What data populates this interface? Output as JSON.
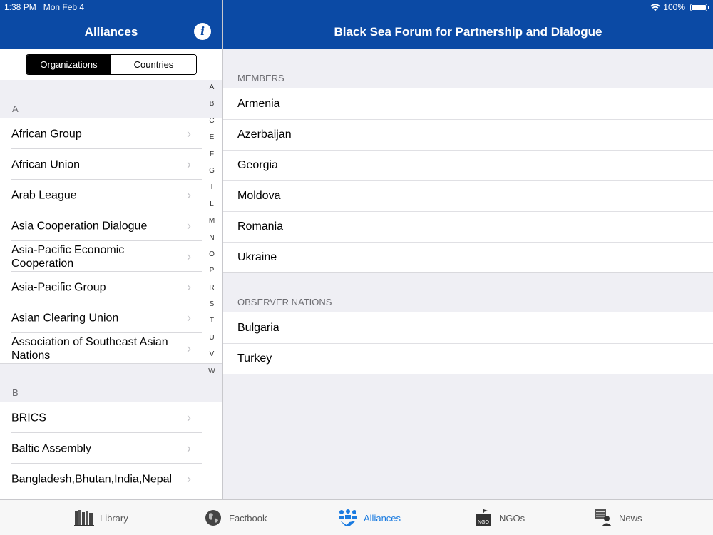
{
  "status": {
    "time": "1:38 PM",
    "date": "Mon Feb 4",
    "battery": "100%"
  },
  "left_nav": {
    "title": "Alliances"
  },
  "right_nav": {
    "title": "Black Sea Forum for Partnership and Dialogue"
  },
  "segment": {
    "organizations": "Organizations",
    "countries": "Countries",
    "selected": "Organizations"
  },
  "sections": [
    {
      "header": "A",
      "items": [
        "African Group",
        "African Union",
        "Arab League",
        "Asia Cooperation Dialogue",
        "Asia-Pacific Economic Cooperation",
        "Asia-Pacific Group",
        "Asian Clearing Union",
        "Association of Southeast Asian Nations"
      ]
    },
    {
      "header": "B",
      "items": [
        "BRICS",
        "Baltic Assembly",
        "Bangladesh,Bhutan,India,Nepal"
      ]
    }
  ],
  "index_letters": [
    "A",
    "B",
    "C",
    "E",
    "F",
    "G",
    "I",
    "L",
    "M",
    "N",
    "O",
    "P",
    "R",
    "S",
    "T",
    "U",
    "V",
    "W"
  ],
  "detail": {
    "members_header": "MEMBERS",
    "members": [
      "Armenia",
      "Azerbaijan",
      "Georgia",
      "Moldova",
      "Romania",
      "Ukraine"
    ],
    "observers_header": "OBSERVER NATIONS",
    "observers": [
      "Bulgaria",
      "Turkey"
    ]
  },
  "tabs": {
    "library": "Library",
    "factbook": "Factbook",
    "alliances": "Alliances",
    "ngos": "NGOs",
    "news": "News",
    "active": "Alliances"
  },
  "colors": {
    "nav_bar": "#0b4aa5",
    "tab_active": "#1a7be0"
  }
}
